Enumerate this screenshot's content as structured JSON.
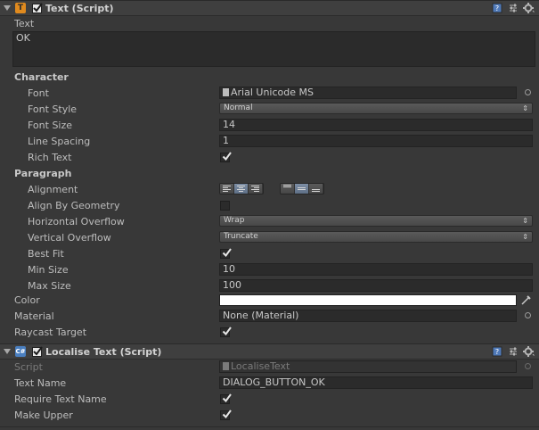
{
  "text_component": {
    "title": "Text (Script)",
    "text_label": "Text",
    "text_value": "OK",
    "character_header": "Character",
    "font": {
      "label": "Font",
      "value": "Arial Unicode MS"
    },
    "font_style": {
      "label": "Font Style",
      "value": "Normal"
    },
    "font_size": {
      "label": "Font Size",
      "value": "14"
    },
    "line_spacing": {
      "label": "Line Spacing",
      "value": "1"
    },
    "rich_text": {
      "label": "Rich Text",
      "checked": true
    },
    "paragraph_header": "Paragraph",
    "alignment": {
      "label": "Alignment",
      "horizontal_selected": "center",
      "vertical_selected": "middle"
    },
    "align_by_geometry": {
      "label": "Align By Geometry",
      "checked": false
    },
    "horizontal_overflow": {
      "label": "Horizontal Overflow",
      "value": "Wrap"
    },
    "vertical_overflow": {
      "label": "Vertical Overflow",
      "value": "Truncate"
    },
    "best_fit": {
      "label": "Best Fit",
      "checked": true
    },
    "min_size": {
      "label": "Min Size",
      "value": "10"
    },
    "max_size": {
      "label": "Max Size",
      "value": "100"
    },
    "color": {
      "label": "Color",
      "value": "#ffffff"
    },
    "material": {
      "label": "Material",
      "value": "None (Material)"
    },
    "raycast_target": {
      "label": "Raycast Target",
      "checked": true
    }
  },
  "localise_component": {
    "title": "Localise Text (Script)",
    "script": {
      "label": "Script",
      "value": "LocaliseText"
    },
    "text_name": {
      "label": "Text Name",
      "value": "DIALOG_BUTTON_OK"
    },
    "require_text_name": {
      "label": "Require Text Name",
      "checked": true
    },
    "make_upper": {
      "label": "Make Upper",
      "checked": true
    }
  },
  "icons": {
    "text_component_icon": "T",
    "localise_component_icon": "C#",
    "help": "help-book-icon",
    "preset": "preset-sliders-icon",
    "settings": "gear-icon",
    "picker": "object-picker-icon",
    "eyedropper": "eyedropper-icon"
  },
  "colors": {
    "background": "#383838",
    "header": "#3f3f3f",
    "field": "#2b2b2b",
    "text_icon_orange": "#e08a1e",
    "script_icon_blue": "#4a7fc0"
  }
}
